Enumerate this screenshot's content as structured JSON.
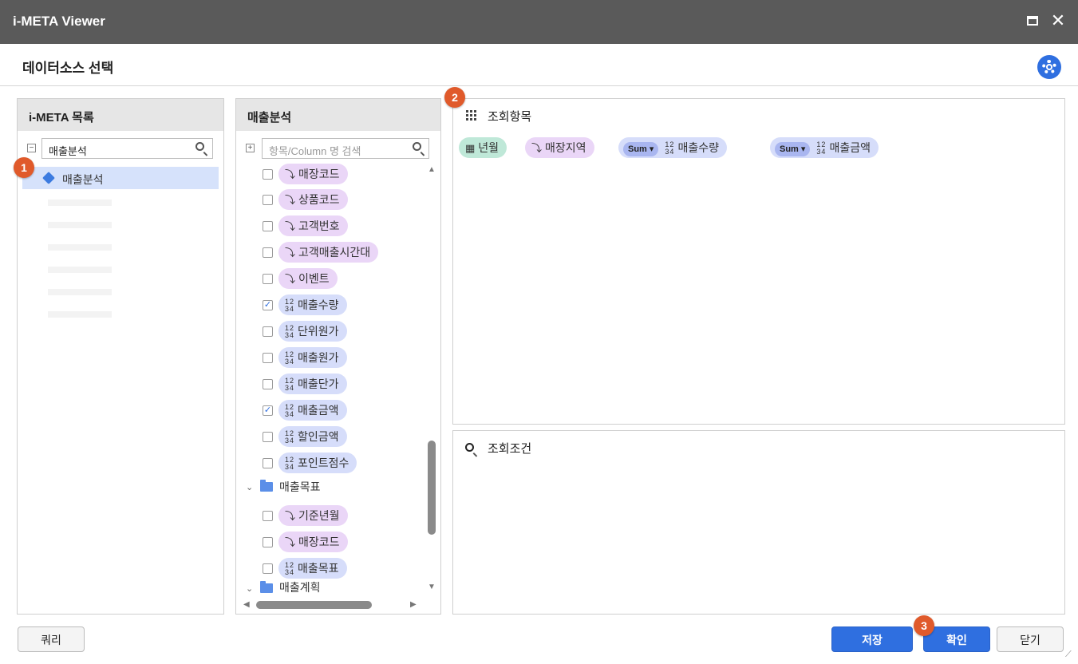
{
  "window": {
    "title": "i-META Viewer"
  },
  "header": {
    "title": "데이터소스 선택"
  },
  "left_panel": {
    "title": "i-META 목록",
    "search_value": "매출분석",
    "selected_item": "매출분석"
  },
  "middle_panel": {
    "title": "매출분석",
    "search_placeholder": "항목/Column 명 검색",
    "fields": [
      {
        "label": "매장코드",
        "type": "dimension",
        "checked": false
      },
      {
        "label": "상품코드",
        "type": "dimension",
        "checked": false
      },
      {
        "label": "고객번호",
        "type": "dimension",
        "checked": false
      },
      {
        "label": "고객매출시간대",
        "type": "dimension",
        "checked": false
      },
      {
        "label": "이벤트",
        "type": "dimension",
        "checked": false
      },
      {
        "label": "매출수량",
        "type": "measure",
        "checked": true
      },
      {
        "label": "단위원가",
        "type": "measure",
        "checked": false
      },
      {
        "label": "매출원가",
        "type": "measure",
        "checked": false
      },
      {
        "label": "매출단가",
        "type": "measure",
        "checked": false
      },
      {
        "label": "매출금액",
        "type": "measure",
        "checked": true
      },
      {
        "label": "할인금액",
        "type": "measure",
        "checked": false
      },
      {
        "label": "포인트점수",
        "type": "measure",
        "checked": false
      }
    ],
    "group1": {
      "label": "매출목표",
      "fields": [
        {
          "label": "기준년월",
          "type": "dimension",
          "checked": false
        },
        {
          "label": "매장코드",
          "type": "dimension",
          "checked": false
        },
        {
          "label": "매출목표",
          "type": "measure",
          "checked": false
        }
      ]
    },
    "group2": {
      "label": "매출계획"
    }
  },
  "query_items": {
    "title": "조회항목",
    "items": [
      {
        "label": "년월",
        "type": "date"
      },
      {
        "label": "매장지역",
        "type": "dimension"
      },
      {
        "label": "매출수량",
        "type": "measure",
        "agg": "Sum"
      },
      {
        "label": "매출금액",
        "type": "measure",
        "agg": "Sum"
      }
    ]
  },
  "query_conditions": {
    "title": "조회조건"
  },
  "footer": {
    "query_button": "쿼리",
    "save_button": "저장",
    "ok_button": "확인",
    "close_button": "닫기"
  },
  "badges": [
    "1",
    "2",
    "3"
  ],
  "colors": {
    "titlebar": "#5a5a5a",
    "accent": "#2f6fe0",
    "badge": "#e05a2b",
    "dimension_pill": "#ead6f7",
    "measure_pill": "#d6ddfa",
    "date_pill": "#bfe8d8"
  }
}
